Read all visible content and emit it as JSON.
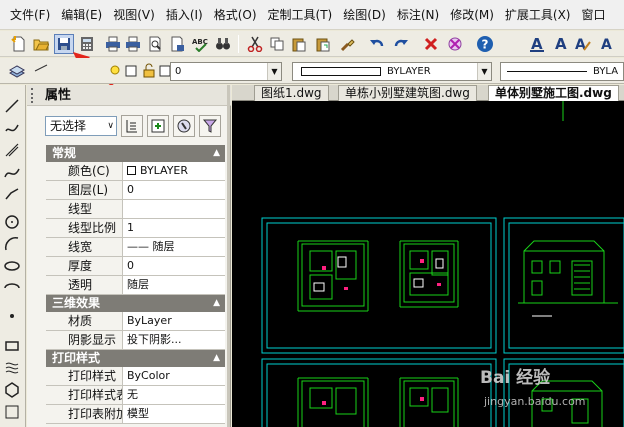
{
  "menu": [
    "文件(F)",
    "编辑(E)",
    "视图(V)",
    "插入(I)",
    "格式(O)",
    "定制工具(T)",
    "绘图(D)",
    "标注(N)",
    "修改(M)",
    "扩展工具(X)",
    "窗口"
  ],
  "tooltip": {
    "text": "保存"
  },
  "layer_toolbar": {
    "layer_value": "0",
    "color_value": "BYLAYER",
    "linetype_value": "BYLA"
  },
  "properties": {
    "title": "属性",
    "selection": "无选择",
    "sections": [
      {
        "name": "常规",
        "rows": [
          {
            "key": "颜色(C)",
            "value": "BYLAYER"
          },
          {
            "key": "图层(L)",
            "value": "0"
          },
          {
            "key": "线型",
            "value": ""
          },
          {
            "key": "线型比例",
            "value": "1"
          },
          {
            "key": "线宽",
            "value": "—— 随层"
          },
          {
            "key": "厚度",
            "value": "0"
          },
          {
            "key": "透明",
            "value": "随层"
          }
        ]
      },
      {
        "name": "三维效果",
        "rows": [
          {
            "key": "材质",
            "value": "ByLayer"
          },
          {
            "key": "阴影显示",
            "value": "投下阴影..."
          }
        ]
      },
      {
        "name": "打印样式",
        "rows": [
          {
            "key": "打印样式",
            "value": "ByColor"
          },
          {
            "key": "打印样式表",
            "value": "无"
          },
          {
            "key": "打印表附加到",
            "value": "模型"
          }
        ]
      }
    ]
  },
  "tabs": [
    {
      "label": "图纸1.dwg"
    },
    {
      "label": "单栋小别墅建筑图.dwg"
    },
    {
      "label": "单体别墅施工图.dwg"
    }
  ],
  "watermark": {
    "brand": "Bai 经验",
    "url": "jingyan.baidu.com"
  },
  "colors": {
    "accent_red": "#e3261c",
    "cad_bg": "#000000",
    "drawing_cyan": "#00e5e5",
    "drawing_green": "#19d219"
  }
}
